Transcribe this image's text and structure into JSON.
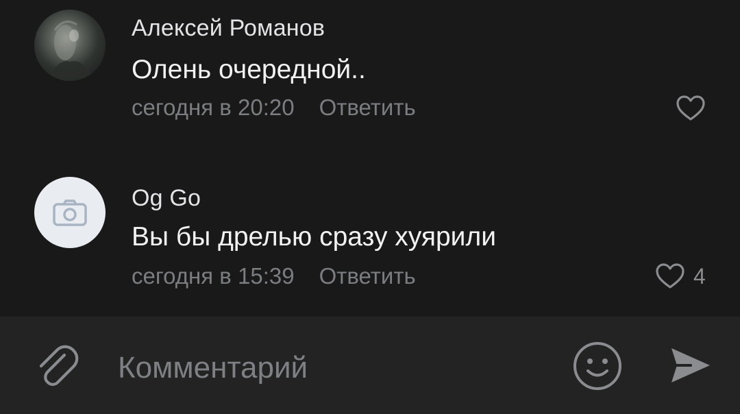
{
  "comments": [
    {
      "author": "Алексей Романов",
      "text": "Олень очередной..",
      "time": "сегодня в 20:20",
      "reply_label": "Ответить",
      "likes": ""
    },
    {
      "author": "Og Go",
      "text": "Вы бы дрелью сразу хуярили",
      "time": "сегодня в 15:39",
      "reply_label": "Ответить",
      "likes": "4"
    }
  ],
  "composer": {
    "placeholder": "Комментарий"
  },
  "icons": {
    "attach": "paperclip-icon",
    "emoji": "smiley-icon",
    "send": "send-icon",
    "like": "heart-icon",
    "camera": "camera-icon"
  },
  "colors": {
    "background": "#19191a",
    "composer_bg": "#232324",
    "text_primary": "#f2f2f3",
    "text_secondary": "#7c7d80",
    "icon": "#8b8c8f"
  }
}
